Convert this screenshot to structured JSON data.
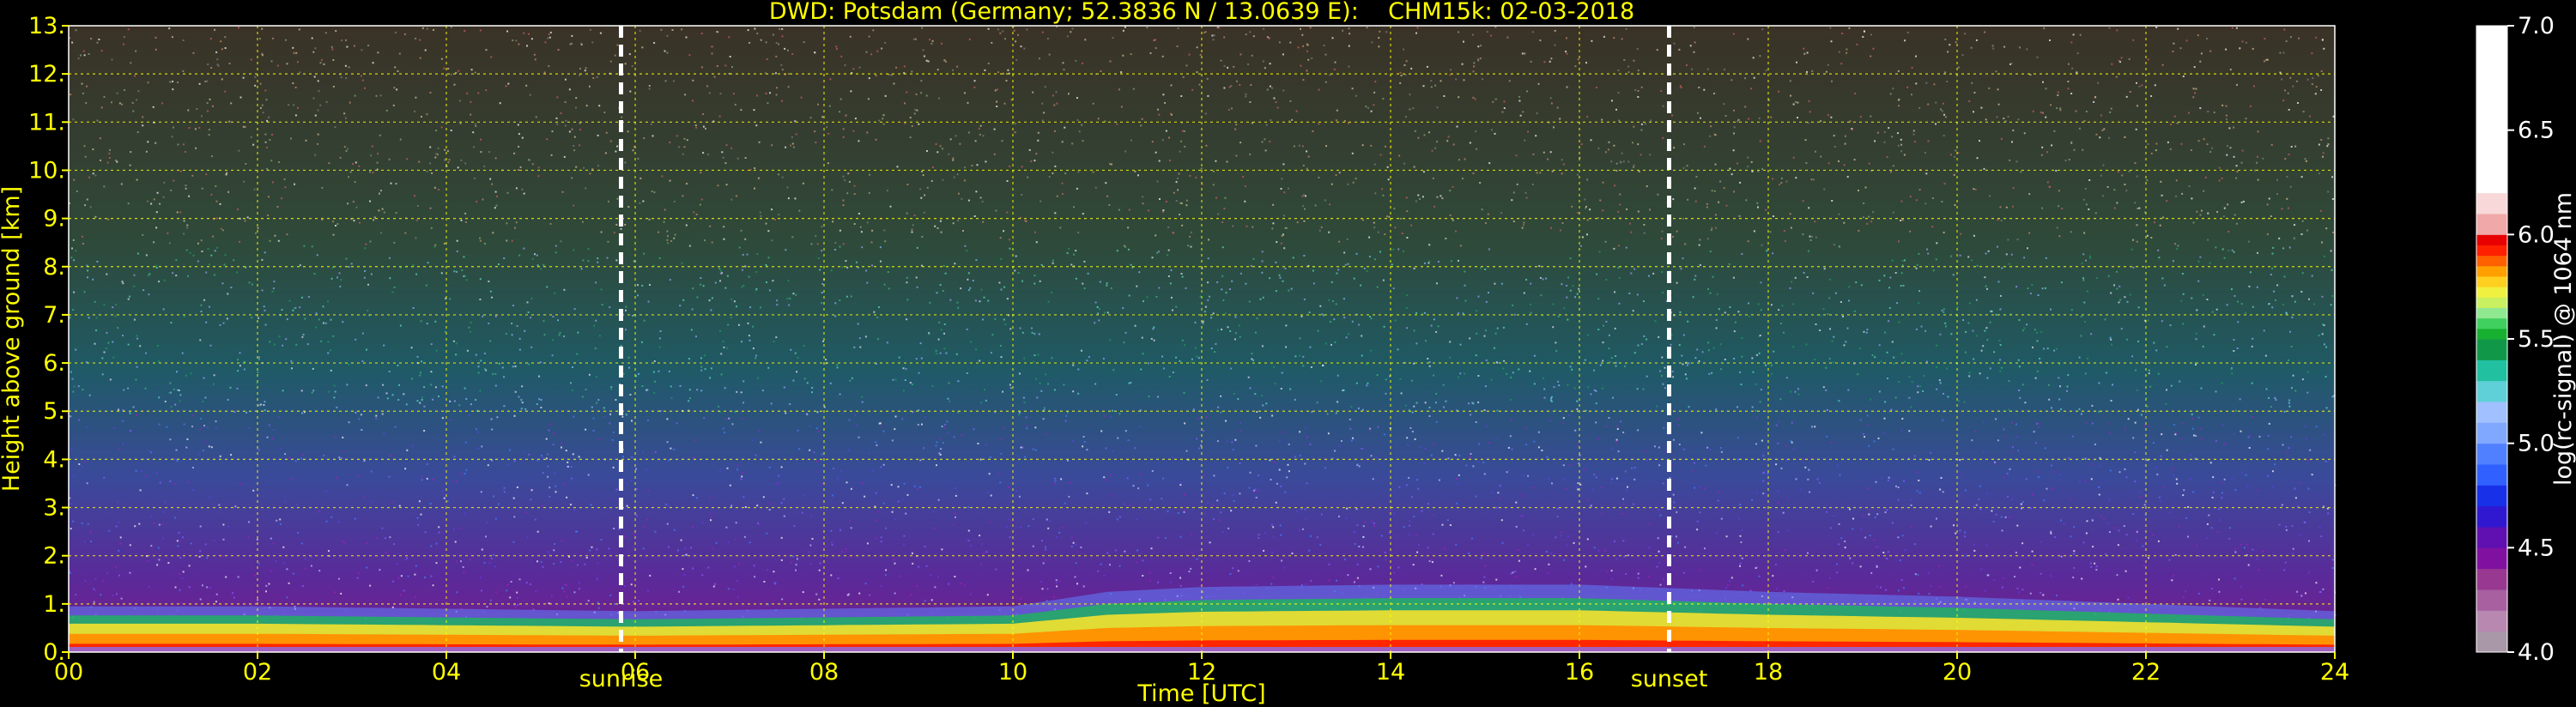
{
  "chart_data": {
    "type": "heatmap",
    "title": "DWD: Potsdam (Germany; 52.3836 N / 13.0639 E):    CHM15k: 02-03-2018",
    "xlabel": "Time [UTC]",
    "ylabel": "Height above ground [km]",
    "xlim": [
      0,
      24
    ],
    "ylim": [
      0,
      13
    ],
    "x_ticks": [
      0,
      2,
      4,
      6,
      8,
      10,
      12,
      14,
      16,
      18,
      20,
      22,
      24
    ],
    "x_tick_labels": [
      "00",
      "02",
      "04",
      "06",
      "08",
      "10",
      "12",
      "14",
      "16",
      "18",
      "20",
      "22",
      "24"
    ],
    "y_ticks": [
      0,
      1,
      2,
      3,
      4,
      5,
      6,
      7,
      8,
      9,
      10,
      11,
      12,
      13
    ],
    "y_tick_labels": [
      "0.",
      "1.",
      "2.",
      "3.",
      "4.",
      "5.",
      "6.",
      "7.",
      "8.",
      "9.",
      "10.",
      "11.",
      "12.",
      "13."
    ],
    "grid": true,
    "events": [
      {
        "label": "sunrise",
        "time": 5.85
      },
      {
        "label": "sunset",
        "time": 16.95
      }
    ],
    "boundary_layer_top_km": {
      "time": [
        0,
        2,
        4,
        6,
        8,
        10,
        11,
        12,
        14,
        16,
        18,
        20,
        22,
        24
      ],
      "height": [
        0.95,
        0.95,
        0.9,
        0.85,
        0.9,
        0.95,
        1.25,
        1.35,
        1.4,
        1.4,
        1.25,
        1.15,
        1.0,
        0.85
      ]
    },
    "colorbar": {
      "label": "log(rc-signal) @ 1064 nm",
      "range": [
        4.0,
        7.0
      ],
      "ticks": [
        4.0,
        4.5,
        5.0,
        5.5,
        6.0,
        6.5,
        7.0
      ],
      "tick_labels": [
        "4.0",
        "4.5",
        "5.0",
        "5.5",
        "6.0",
        "6.5",
        "7.0"
      ],
      "bands": [
        "#a898a8",
        "#b888b0",
        "#a860a0",
        "#983890",
        "#8010a0",
        "#6010b0",
        "#3018d0",
        "#1830e8",
        "#3060ff",
        "#5080ff",
        "#80a8ff",
        "#a0c0ff",
        "#60d0d8",
        "#20c0a0",
        "#109848",
        "#18b030",
        "#40d060",
        "#90e890",
        "#c8f060",
        "#f0f040",
        "#ffd020",
        "#ffa000",
        "#ff6000",
        "#ff2000",
        "#e80000",
        "#f0a8a8",
        "#f8d8d8",
        "#ffffff"
      ],
      "band_edges": [
        4.0,
        4.1,
        4.2,
        4.3,
        4.4,
        4.5,
        4.6,
        4.7,
        4.8,
        4.9,
        5.0,
        5.1,
        5.2,
        5.3,
        5.4,
        5.5,
        5.55,
        5.6,
        5.65,
        5.7,
        5.75,
        5.8,
        5.85,
        5.9,
        5.95,
        6.0,
        6.1,
        6.2,
        7.0
      ]
    }
  }
}
